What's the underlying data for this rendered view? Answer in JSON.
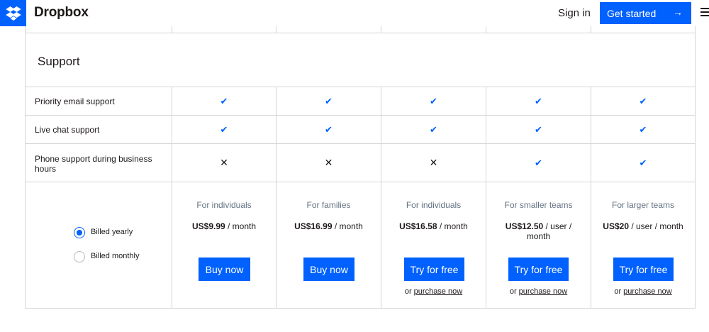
{
  "header": {
    "brand": "Dropbox",
    "sign_in": "Sign in",
    "cta": "Get started",
    "cta_arrow": "→",
    "brand_color": "#0061fe"
  },
  "section": {
    "title": "Support"
  },
  "rows": [
    {
      "label": "Priority email support",
      "values": [
        "check",
        "check",
        "check",
        "check",
        "check"
      ]
    },
    {
      "label": "Live chat support",
      "values": [
        "check",
        "check",
        "check",
        "check",
        "check"
      ]
    },
    {
      "label": "Phone support during business hours",
      "values": [
        "cross",
        "cross",
        "cross",
        "check",
        "check"
      ]
    }
  ],
  "glyphs": {
    "check": "✔",
    "cross": "✕"
  },
  "billing": {
    "options": [
      {
        "label": "Billed yearly",
        "selected": true
      },
      {
        "label": "Billed monthly",
        "selected": false
      }
    ]
  },
  "plans": [
    {
      "for": "For individuals",
      "price": "US$9.99",
      "unit": " / month",
      "button": "Buy now",
      "or_text": "",
      "link": ""
    },
    {
      "for": "For families",
      "price": "US$16.99",
      "unit": " / month",
      "button": "Buy now",
      "or_text": "",
      "link": ""
    },
    {
      "for": "For individuals",
      "price": "US$16.58",
      "unit": " / month",
      "button": "Try for free",
      "or_text": "or ",
      "link": "purchase now"
    },
    {
      "for": "For smaller teams",
      "price": "US$12.50",
      "unit": " / user / month",
      "button": "Try for free",
      "or_text": "or ",
      "link": "purchase now"
    },
    {
      "for": "For larger teams",
      "price": "US$20",
      "unit": " / user / month",
      "button": "Try for free",
      "or_text": "or ",
      "link": "purchase now"
    }
  ]
}
